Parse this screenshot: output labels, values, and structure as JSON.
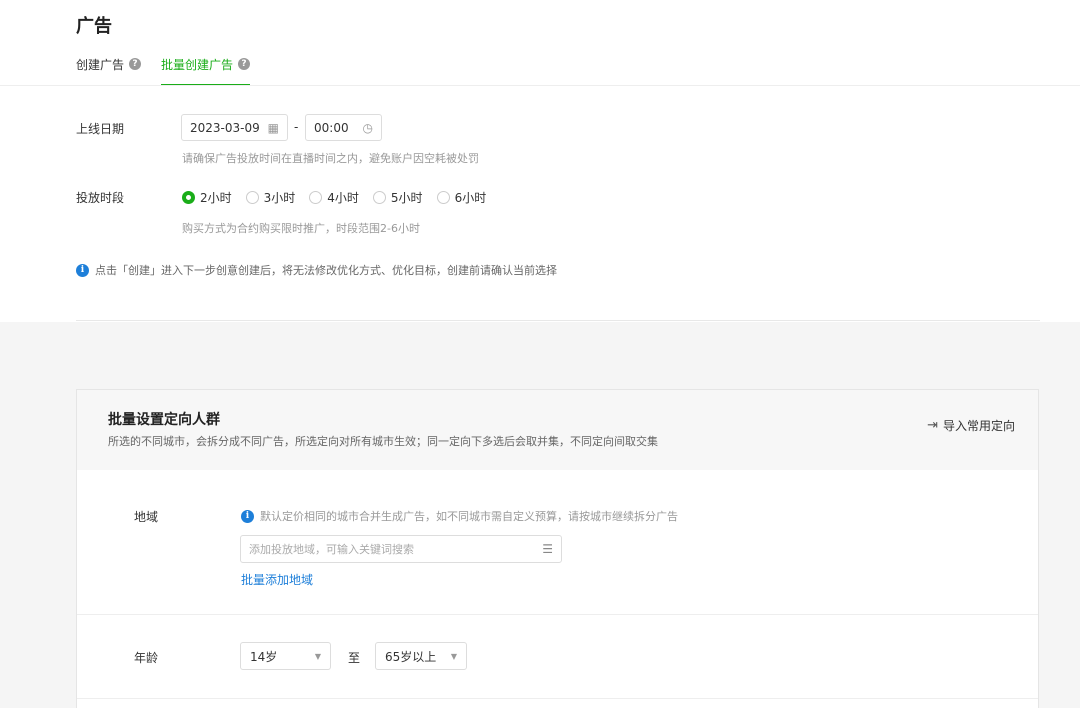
{
  "header": {
    "title": "广告"
  },
  "tabs": [
    {
      "label": "创建广告",
      "active": false
    },
    {
      "label": "批量创建广告",
      "active": true
    }
  ],
  "launch_date": {
    "label": "上线日期",
    "date_value": "2023-03-09",
    "separator": "-",
    "time_value": "00:00",
    "hint": "请确保广告投放时间在直播时间之内，避免账户因空耗被处罚"
  },
  "slot": {
    "label": "投放时段",
    "options": [
      "2小时",
      "3小时",
      "4小时",
      "5小时",
      "6小时"
    ],
    "selected": "2小时",
    "hint": "购买方式为合约购买限时推广，时段范围2-6小时"
  },
  "notice": "点击「创建」进入下一步创意创建后，将无法修改优化方式、优化目标，创建前请确认当前选择",
  "targeting": {
    "title": "批量设置定向人群",
    "desc": "所选的不同城市，会拆分成不同广告，所选定向对所有城市生效；同一定向下多选后会取并集，不同定向间取交集",
    "import_label": "导入常用定向",
    "region": {
      "label": "地域",
      "hint": "默认定价相同的城市合并生成广告，如不同城市需自定义预算，请按城市继续拆分广告",
      "placeholder": "添加投放地域，可输入关键词搜索",
      "bulk_add": "批量添加地域"
    },
    "age": {
      "label": "年龄",
      "from": "14岁",
      "to_label": "至",
      "to": "65岁以上"
    }
  },
  "colors": {
    "accent": "#1aad19",
    "link": "#1e7fd9"
  }
}
